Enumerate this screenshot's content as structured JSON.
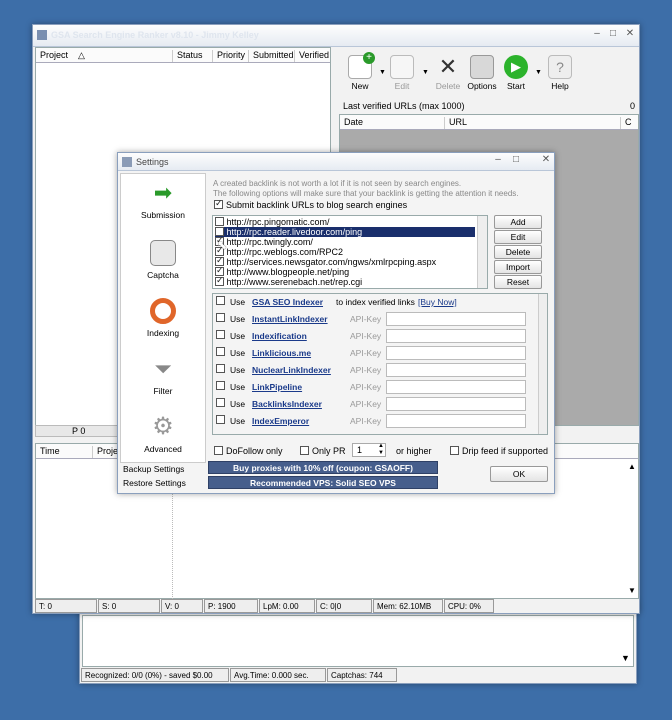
{
  "main_window": {
    "title": "GSA Search Engine Ranker v8.10 - Jimmy Kelley",
    "project_columns": [
      "Project",
      "Status",
      "Priority",
      "Submitted",
      "Verified"
    ],
    "toolbar": {
      "new": "New",
      "edit": "Edit",
      "delete": "Delete",
      "options": "Options",
      "start": "Start",
      "help": "Help"
    },
    "verified_label": "Last verified URLs (max 1000)",
    "verified_count": "0",
    "url_columns": [
      "Date",
      "URL",
      "C"
    ],
    "project_footer": "P 0",
    "log_columns": [
      "Time",
      "Project"
    ],
    "status": {
      "t": "T: 0",
      "s": "S: 0",
      "v": "V: 0",
      "p": "P: 1900",
      "lpm": "LpM: 0.00",
      "c": "C: 0|0",
      "mem": "Mem: 62.10MB",
      "cpu": "CPU: 0%"
    }
  },
  "captcha_window": {
    "recognized": "Recognized: 0/0 (0%) - saved $0.00",
    "avg": "Avg.Time: 0.000 sec.",
    "captchas": "Captchas: 744"
  },
  "settings": {
    "title": "Settings",
    "nav": [
      {
        "label": "Submission",
        "icon": "green-arrow-icon"
      },
      {
        "label": "Captcha",
        "icon": "captcha-icon"
      },
      {
        "label": "Indexing",
        "icon": "lifebuoy-icon"
      },
      {
        "label": "Filter",
        "icon": "funnel-icon"
      },
      {
        "label": "Advanced",
        "icon": "gear-icon"
      }
    ],
    "backup": "Backup Settings",
    "restore": "Restore Settings",
    "info1": "A created backlink is not worth a lot if it is not seen by search engines.",
    "info2": "The following options will make sure that your backlink is getting the attention it needs.",
    "submit_blog": "Submit backlink URLs to blog search engines",
    "ping_urls": [
      {
        "url": "http://rpc.pingomatic.com/",
        "checked": false
      },
      {
        "url": "http://rpc.reader.livedoor.com/ping",
        "checked": false
      },
      {
        "url": "http://rpc.twingly.com/",
        "checked": true
      },
      {
        "url": "http://rpc.weblogs.com/RPC2",
        "checked": true
      },
      {
        "url": "http://services.newsgator.com/ngws/xmlrpcping.aspx",
        "checked": true
      },
      {
        "url": "http://www.blogpeople.net/ping",
        "checked": true
      },
      {
        "url": "http://www.serenebach.net/rep.cgi",
        "checked": true
      }
    ],
    "buttons": {
      "add": "Add",
      "edit": "Edit",
      "delete": "Delete",
      "import": "Import",
      "reset": "Reset"
    },
    "use_label": "Use",
    "gsa_row": {
      "name": "GSA SEO Indexer",
      "mid": "to index verified links",
      "link": "[Buy Now]"
    },
    "indexers": [
      "InstantLinkIndexer",
      "Indexification",
      "Linklicious.me",
      "NuclearLinkIndexer",
      "LinkPipeline",
      "BacklinksIndexer",
      "IndexEmperor"
    ],
    "api_label": "API-Key",
    "dofollow": "DoFollow only",
    "only_pr": "Only PR",
    "pr_value": "1",
    "or_higher": "or higher",
    "drip": "Drip feed if supported",
    "promo1": "Buy proxies with 10% off  (coupon: GSAOFF)",
    "promo2": "Recommended VPS: Solid SEO VPS",
    "ok": "OK"
  }
}
